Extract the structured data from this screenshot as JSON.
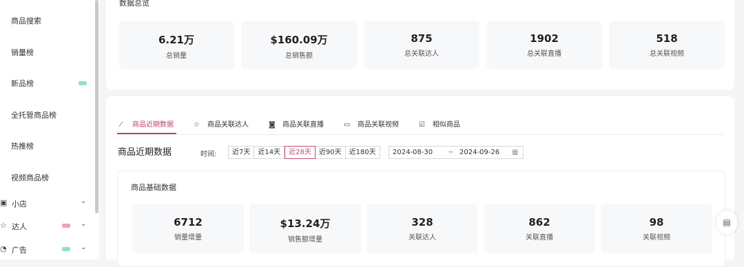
{
  "sidebar": {
    "items": [
      {
        "label": "商品搜索"
      },
      {
        "label": "销量榜"
      },
      {
        "label": "新品榜",
        "badge_color": "#8fe0d4"
      },
      {
        "label": "全托管商品榜"
      },
      {
        "label": "热推榜"
      },
      {
        "label": "视频商品榜"
      }
    ],
    "groups": [
      {
        "label": "小店",
        "icon": "shop-icon"
      },
      {
        "label": "达人",
        "icon": "star-icon",
        "badge_color": "#f0a0b8"
      },
      {
        "label": "广告",
        "icon": "ad-icon",
        "badge_color": "#8fe0d4"
      }
    ]
  },
  "overview": {
    "title": "数据总览",
    "cards": [
      {
        "value": "6.21万",
        "label": "总销量"
      },
      {
        "value": "$160.09万",
        "label": "总销售额"
      },
      {
        "value": "875",
        "label": "总关联达人"
      },
      {
        "value": "1902",
        "label": "总关联直播"
      },
      {
        "value": "518",
        "label": "总关联视频"
      }
    ]
  },
  "tabs": [
    {
      "label": "商品近期数据",
      "icon": "line-chart-icon",
      "active": true
    },
    {
      "label": "商品关联达人",
      "icon": "star-icon"
    },
    {
      "label": "商品关联直播",
      "icon": "live-icon"
    },
    {
      "label": "商品关联视频",
      "icon": "video-icon"
    },
    {
      "label": "相似商品",
      "icon": "check-box-icon"
    }
  ],
  "recent": {
    "title": "商品近期数据",
    "time_label": "时间:",
    "ranges": [
      "近7天",
      "近14天",
      "近28天",
      "近90天",
      "近180天"
    ],
    "selected_range": "近28天",
    "date_start": "2024-08-30",
    "date_end": "2024-09-26",
    "date_arrow": "→"
  },
  "basic": {
    "title": "商品基础数据",
    "cards": [
      {
        "value": "6712",
        "label": "销量增量"
      },
      {
        "value": "$13.24万",
        "label": "销售额增量"
      },
      {
        "value": "328",
        "label": "关联达人"
      },
      {
        "value": "862",
        "label": "关联直播"
      },
      {
        "value": "98",
        "label": "关联视频"
      }
    ]
  },
  "accent_color": "#b8486a"
}
